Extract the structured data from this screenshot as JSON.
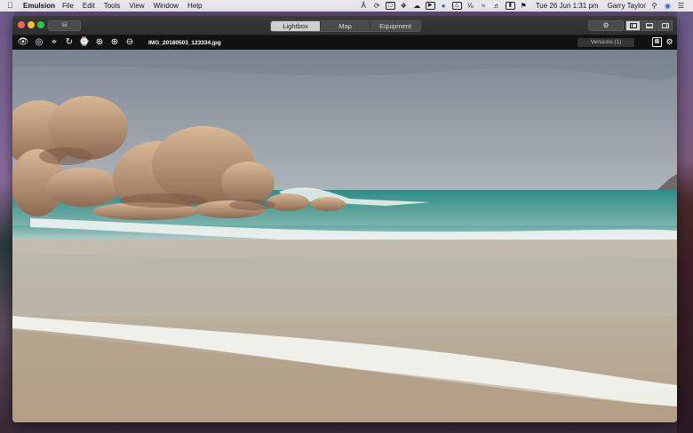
{
  "menubar": {
    "apple": "",
    "app_name": "Emulsion",
    "menus": [
      "File",
      "Edit",
      "Tools",
      "View",
      "Window",
      "Help"
    ],
    "datetime": "Tue 26 Jun  1:31 pm",
    "user": "Garry Taylor"
  },
  "titlebar": {
    "import_icon": "import-icon",
    "tabs": [
      {
        "label": "Lightbox",
        "active": true
      },
      {
        "label": "Map",
        "active": false
      },
      {
        "label": "Equipment",
        "active": false
      }
    ]
  },
  "toolbar": {
    "filename": "IMG_20180503_123334.jpg",
    "versions_label": "Versions (1)",
    "tools": [
      "eye-icon",
      "target-icon",
      "crop-icon",
      "rotate-icon",
      "straighten-icon",
      "zoom-fit-icon",
      "zoom-in-icon",
      "zoom-out-icon"
    ]
  },
  "colors": {
    "window_bg": "#262626",
    "toolbar_bg": "#111111",
    "tab_active": "#cfcfcf"
  }
}
